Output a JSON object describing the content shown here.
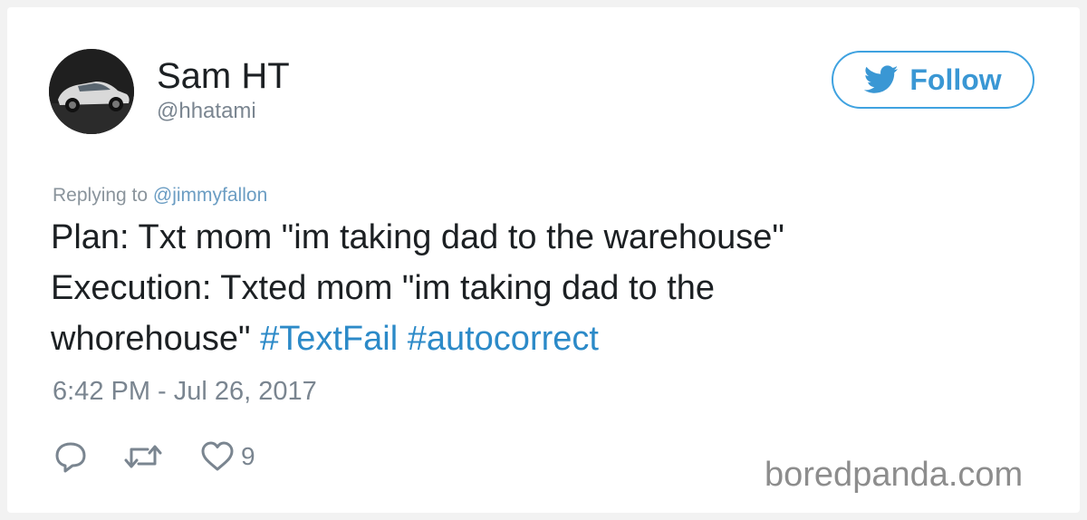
{
  "author": {
    "name": "Sam HT",
    "handle": "@hhatami",
    "avatar_icon": "car-avatar"
  },
  "follow_button": {
    "label": "Follow",
    "icon": "twitter-bird-icon",
    "color": "#3a97d4"
  },
  "reply_context": {
    "prefix": "Replying to",
    "mention": "@jimmyfallon"
  },
  "tweet": {
    "line1": "Plan: Txt mom \"im taking dad to the warehouse\"",
    "line2": "Execution: Txted mom \"im taking dad to the",
    "line3_text": "whorehouse\"",
    "hashtags": [
      "#TextFail",
      "#autocorrect"
    ],
    "hashtag_color": "#2c8ac8"
  },
  "timestamp": "6:42 PM - Jul 26, 2017",
  "actions": {
    "reply_icon": "reply-icon",
    "retweet_icon": "retweet-icon",
    "like_icon": "heart-icon",
    "like_count": "9"
  },
  "watermark": "boredpanda.com"
}
